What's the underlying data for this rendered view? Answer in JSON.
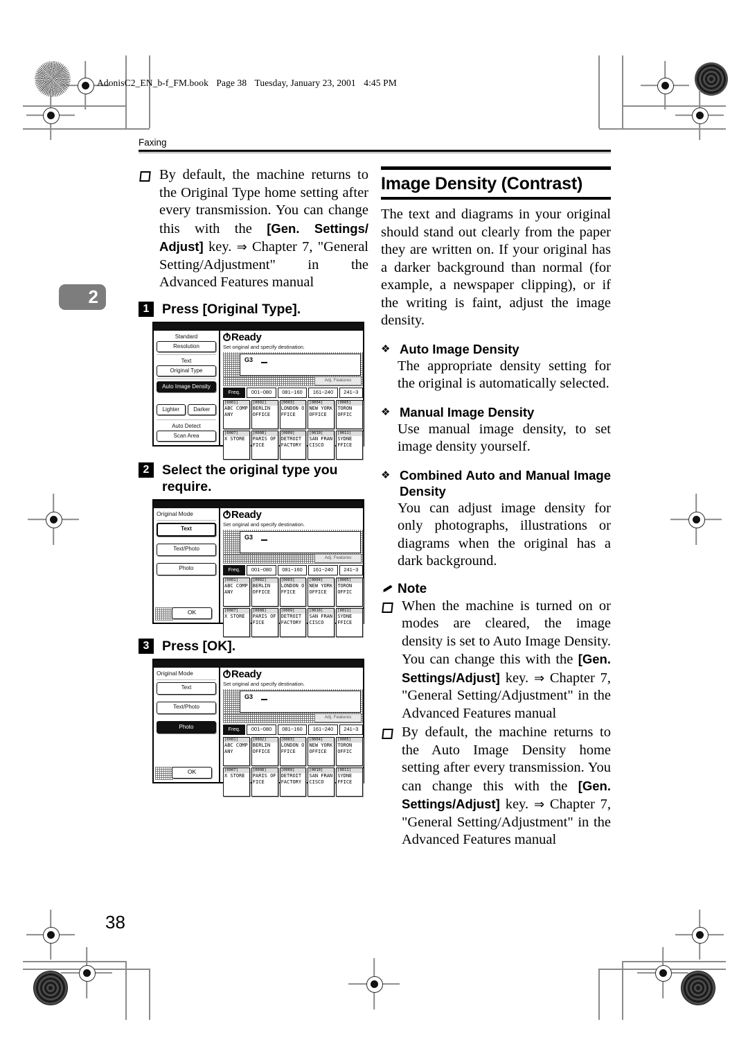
{
  "file_header": {
    "filename": "AdonisC2_EN_b-f_FM.book",
    "page_label": "Page 38",
    "date": "Tuesday, January 23, 2001",
    "time": "4:45 PM"
  },
  "running_head": "Faxing",
  "chapter_tab": "2",
  "page_number": "38",
  "left_column": {
    "note_item": {
      "text_1": "By default, the machine returns to the Original Type home setting after every transmission. You can change this with the ",
      "bold_1": "[Gen. Settings/ Adjust]",
      "text_2": " key. ",
      "arrow": "⇒",
      "text_3": " Chapter 7, \"General Setting/Adjustment\" in the Advanced Features manual"
    },
    "steps": [
      {
        "num": "1",
        "label": "Press [Original Type]."
      },
      {
        "num": "2",
        "label": "Select the original type you require."
      },
      {
        "num": "3",
        "label": "Press [OK]."
      }
    ]
  },
  "right_column": {
    "heading": "Image Density (Contrast)",
    "intro": "The text and diagrams in your original should stand out clearly from the paper they are written on. If your original has a darker background than normal (for example, a newspaper clipping), or if the writing is faint, adjust the image density.",
    "sections": [
      {
        "title": "Auto Image Density",
        "body": "The appropriate density setting for the original is automatically selected."
      },
      {
        "title": "Manual Image Density",
        "body": "Use manual image density, to set image density yourself."
      },
      {
        "title": "Combined Auto and Manual Image Density",
        "body": "You can adjust image density for only photographs, illustrations or diagrams when the original has a dark background."
      }
    ],
    "note_heading": "Note",
    "notes": [
      {
        "text_1": "When the machine is turned on or modes are cleared, the image density is set to Auto Image Density. You can change this with the ",
        "bold_1": "[Gen. Settings/Adjust]",
        "text_2": " key. ",
        "arrow": "⇒",
        "text_3": " Chapter 7, \"General Setting/Adjustment\" in the Advanced Features manual"
      },
      {
        "text_1": "By default, the machine returns to the Auto Image Density home setting after every transmission. You can change this with the ",
        "bold_1": "[Gen. Settings/Adjust]",
        "text_2": " key. ",
        "arrow": "⇒",
        "text_3": " Chapter 7, \"General Setting/Adjustment\" in the Advanced Features manual"
      }
    ]
  },
  "lcd_common": {
    "status": "Ready",
    "prompt": "Set original and specify destination.",
    "line_label": "G3",
    "adj_features_button": "Adj. Features",
    "tabs": [
      "Freq.",
      "001~080",
      "081~160",
      "161~240",
      "241~3"
    ],
    "destinations_row1": [
      {
        "num": "[0001]",
        "name": "ABC COMP\nANY"
      },
      {
        "num": "[0002]",
        "name": "BERLIN\nOFFICE"
      },
      {
        "num": "[0003]",
        "name": "LONDON O\nFFICE"
      },
      {
        "num": "[0004]",
        "name": "NEW YORK\n OFFICE"
      },
      {
        "num": "[0005]",
        "name": "TORON\nOFFIC"
      }
    ],
    "destinations_row2": [
      {
        "num": "[0007]",
        "name": "X STORE"
      },
      {
        "num": "[0008]",
        "name": "PARIS OF\nFICE"
      },
      {
        "num": "[0009]",
        "name": "DETROIT\nFACTORY"
      },
      {
        "num": "[0010]",
        "name": "SAN FRAN\nCISCO"
      },
      {
        "num": "[0011]",
        "name": "SYDNE\nFFICE"
      }
    ],
    "ok_button": "OK"
  },
  "lcd_1": {
    "labels": {
      "resolution_value": "Standard",
      "resolution_button": "Resolution",
      "original_type_value": "Text",
      "original_type_button": "Original Type",
      "auto_image_density_button": "Auto Image Density",
      "lighter_button": "Lighter",
      "darker_button": "Darker",
      "scan_area_value": "Auto Detect",
      "scan_area_button": "Scan Area"
    }
  },
  "lcd_2": {
    "title": "Original Mode",
    "options": [
      "Text",
      "Text/Photo",
      "Photo"
    ],
    "selected": "Text"
  },
  "lcd_3": {
    "title": "Original Mode",
    "options": [
      "Text",
      "Text/Photo",
      "Photo"
    ],
    "selected": "Photo"
  }
}
